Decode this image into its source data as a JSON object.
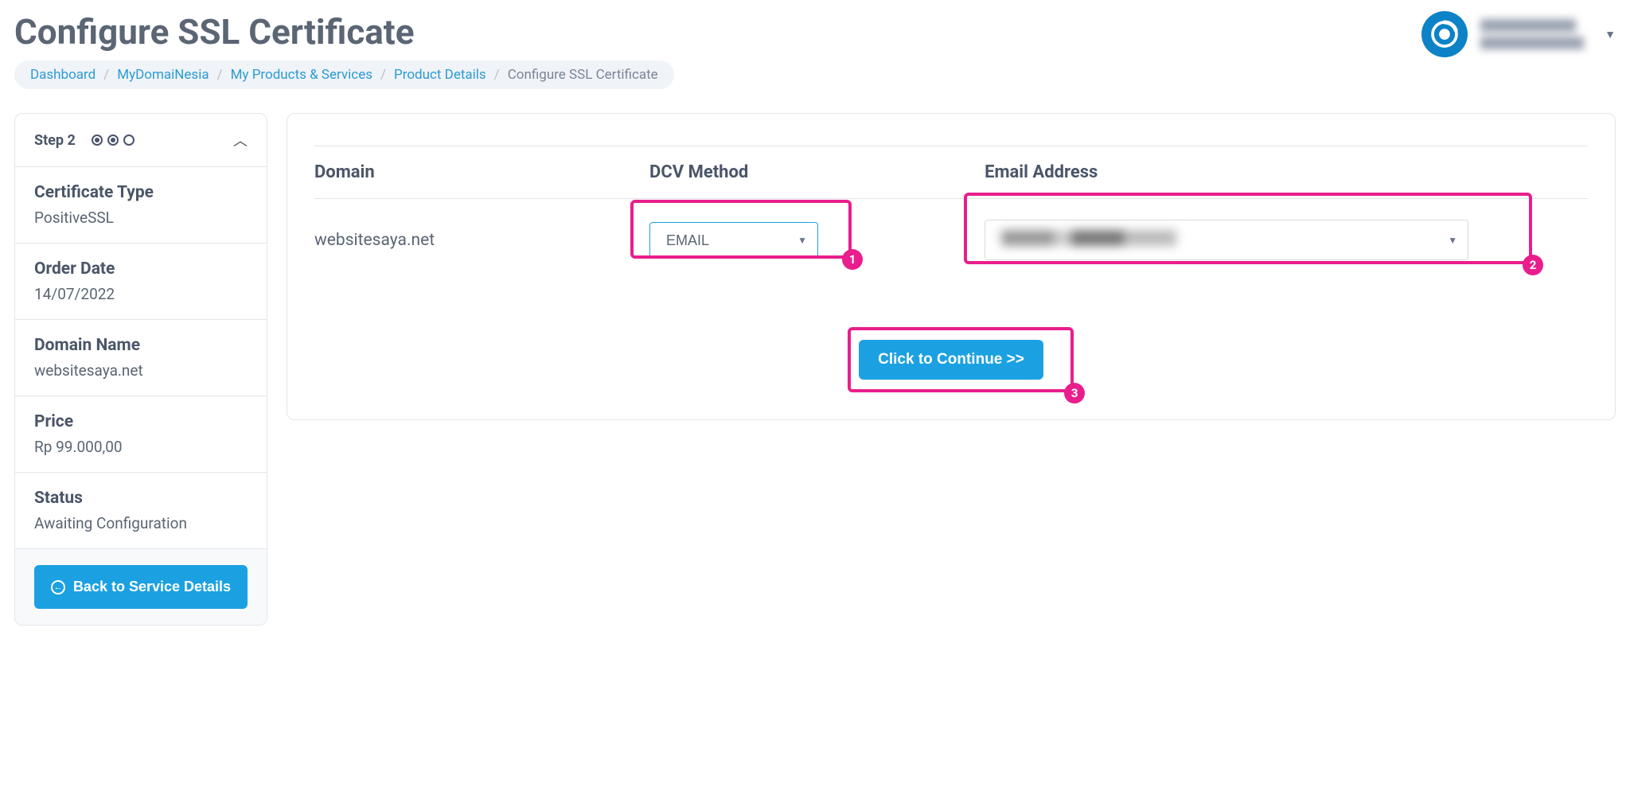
{
  "header": {
    "title": "Configure SSL Certificate"
  },
  "breadcrumb": {
    "items": [
      {
        "label": "Dashboard"
      },
      {
        "label": "MyDomaiNesia"
      },
      {
        "label": "My Products & Services"
      },
      {
        "label": "Product Details"
      }
    ],
    "current": "Configure SSL Certificate"
  },
  "sidebar": {
    "step_label": "Step 2",
    "cert_type_title": "Certificate Type",
    "cert_type_value": "PositiveSSL",
    "order_date_title": "Order Date",
    "order_date_value": "14/07/2022",
    "domain_name_title": "Domain Name",
    "domain_name_value": "websitesaya.net",
    "price_title": "Price",
    "price_value": "Rp 99.000,00",
    "status_title": "Status",
    "status_value": "Awaiting Configuration",
    "back_button": "Back to Service Details"
  },
  "table": {
    "columns": {
      "domain": "Domain",
      "dcv": "DCV Method",
      "email": "Email Address"
    },
    "row": {
      "domain": "websitesaya.net",
      "dcv_value": "EMAIL"
    }
  },
  "callouts": {
    "c1": "1",
    "c2": "2",
    "c3": "3"
  },
  "actions": {
    "continue": "Click to Continue >>"
  }
}
